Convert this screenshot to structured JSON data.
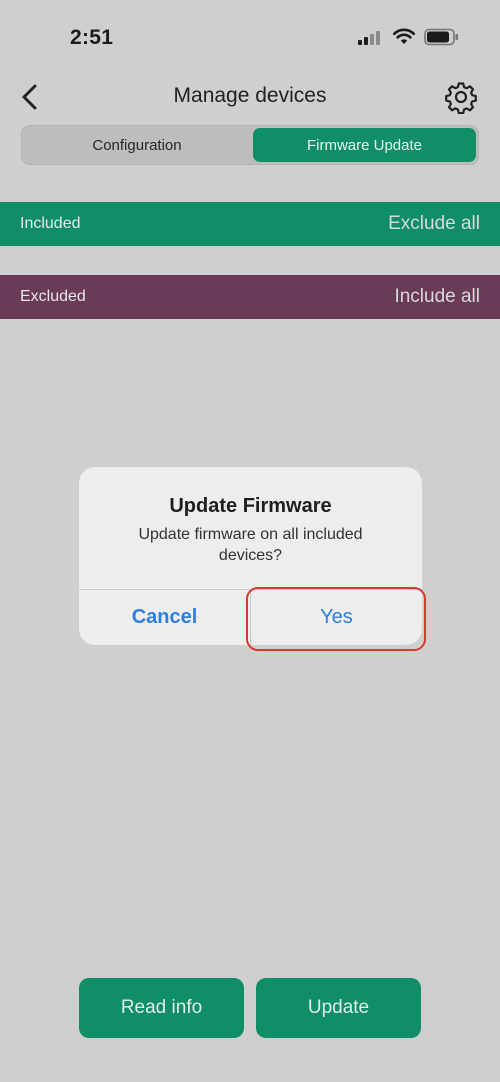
{
  "status_bar": {
    "time": "2:51",
    "icons": [
      "cellular-signal-icon",
      "wifi-icon",
      "battery-icon"
    ]
  },
  "nav": {
    "title": "Manage devices",
    "back_icon": "chevron-left-icon",
    "settings_icon": "gear-icon"
  },
  "segmented": {
    "options": [
      {
        "label": "Configuration",
        "selected": false
      },
      {
        "label": "Firmware Update",
        "selected": true
      }
    ]
  },
  "sections": {
    "included": {
      "label": "Included",
      "action": "Exclude all",
      "color": "#0f8e67"
    },
    "excluded": {
      "label": "Excluded",
      "action": "Include all",
      "color": "#6a3b56"
    }
  },
  "dialog": {
    "title": "Update Firmware",
    "message": "Update firmware on all included devices?",
    "cancel_label": "Cancel",
    "confirm_label": "Yes"
  },
  "footer": {
    "read_info_label": "Read info",
    "update_label": "Update"
  },
  "colors": {
    "accent": "#0f8e67",
    "excluded": "#6a3b56",
    "link": "#2f7ee0",
    "highlight": "#d83a2a"
  }
}
